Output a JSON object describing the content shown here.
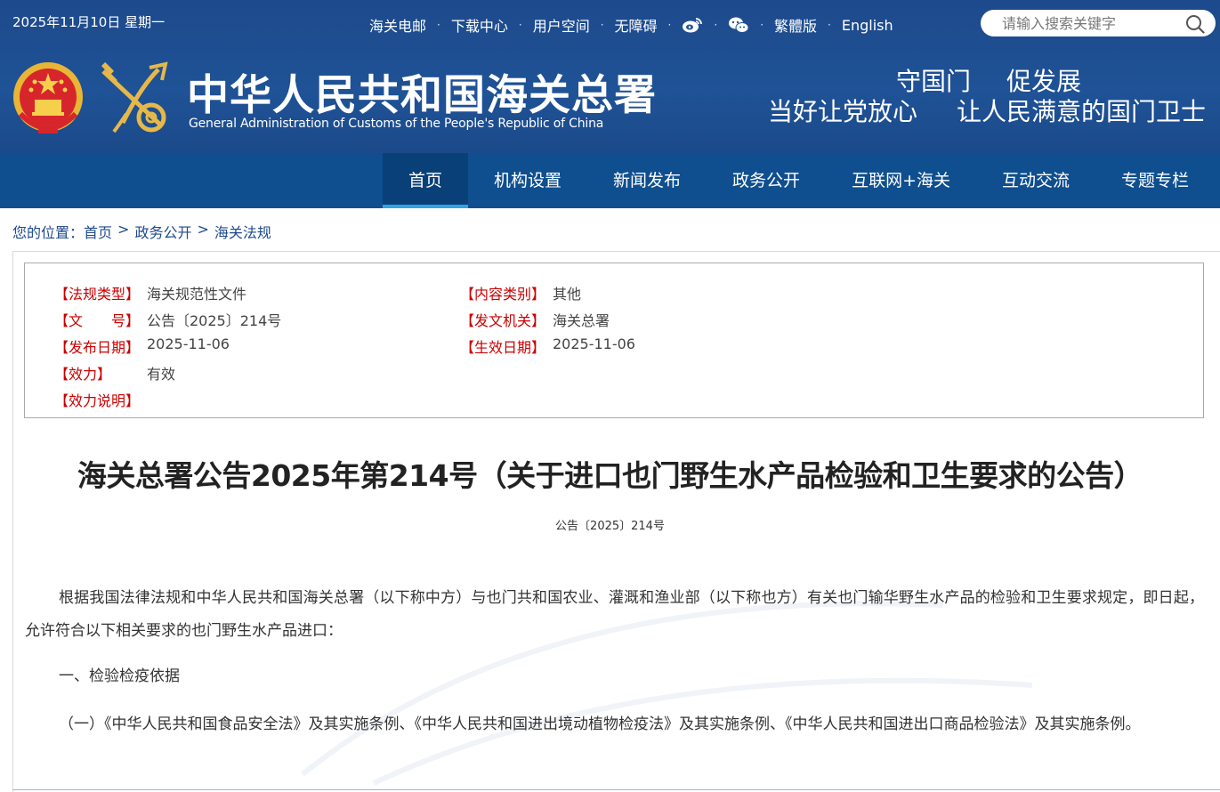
{
  "header": {
    "date": "2025年11月10日 星期一",
    "top_links": [
      "海关电邮",
      "下载中心",
      "用户空间",
      "无障碍"
    ],
    "weibo_icon": "weibo-icon",
    "wechat_icon": "wechat-icon",
    "traditional_label": "繁體版",
    "english_label": "English",
    "search_placeholder": "请输入搜索关键字",
    "site_title": "中华人民共和国海关总署",
    "site_subtitle": "General Administration of Customs of the People's Republic of China",
    "slogan_a1": "守国门",
    "slogan_a2": "促发展",
    "slogan_b1": "当好让党放心",
    "slogan_b2": "让人民满意的国门卫士",
    "colors": {
      "header_bg": "#1f5296",
      "nav_bg": "#0f4f8f",
      "nav_active_underline": "#2fa3e6",
      "label_red": "#cc0000"
    }
  },
  "nav": {
    "items": [
      "首页",
      "机构设置",
      "新闻发布",
      "政务公开",
      "互联网+海关",
      "互动交流",
      "专题专栏"
    ],
    "active": "首页"
  },
  "breadcrumb": {
    "prefix": "您的位置：",
    "items": [
      "首页",
      "政务公开",
      "海关法规"
    ],
    "separator": ">"
  },
  "meta": {
    "law_type_label": "【法规类型】",
    "law_type_value": "海关规范性文件",
    "content_category_label": "【内容类别】",
    "content_category_value": "其他",
    "doc_no_label": "【文　　号】",
    "doc_no_value": "公告〔2025〕214号",
    "issuer_label": "【发文机关】",
    "issuer_value": "海关总署",
    "publish_date_label": "【发布日期】",
    "publish_date_value": "2025-11-06",
    "effective_date_label": "【生效日期】",
    "effective_date_value": "2025-11-06",
    "validity_label": "【效力】",
    "validity_value": "有效",
    "validity_note_label": "【效力说明】",
    "validity_note_value": ""
  },
  "document": {
    "title": "海关总署公告2025年第214号（关于进口也门野生水产品检验和卫生要求的公告）",
    "number": "公告〔2025〕214号",
    "paragraphs": [
      "根据我国法律法规和中华人民共和国海关总署（以下称中方）与也门共和国农业、灌溉和渔业部（以下称也方）有关也门输华野生水产品的检验和卫生要求规定，即日起，允许符合以下相关要求的也门野生水产品进口：",
      "一、检验检疫依据",
      "（一）《中华人民共和国食品安全法》及其实施条例、《中华人民共和国进出境动植物检疫法》及其实施条例、《中华人民共和国进出口商品检验法》及其实施条例。"
    ]
  }
}
